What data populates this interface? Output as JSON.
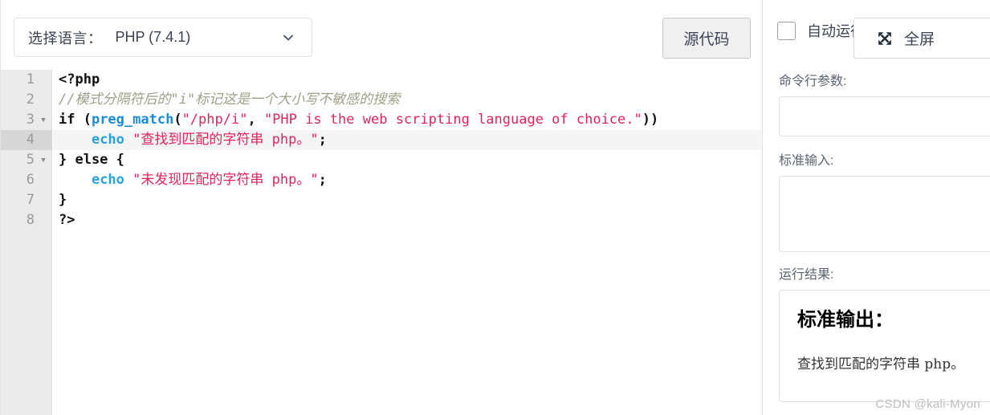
{
  "editor_toolbar": {
    "language_label": "选择语言：",
    "language_value": "PHP (7.4.1)",
    "chevron_icon": "chevron-down-icon",
    "source_button": "源代码"
  },
  "code": {
    "language": "php",
    "active_line": 4,
    "lines": [
      {
        "num": "1",
        "foldable": false,
        "active": false,
        "tokens": [
          {
            "t": "tag",
            "v": "<?php"
          }
        ]
      },
      {
        "num": "2",
        "foldable": false,
        "active": false,
        "tokens": [
          {
            "t": "comment",
            "v": "//模式分隔符后的\"i\"标记这是一个大小写不敏感的搜索"
          }
        ]
      },
      {
        "num": "3",
        "foldable": true,
        "active": false,
        "tokens": [
          {
            "t": "keyword",
            "v": "if ("
          },
          {
            "t": "func",
            "v": "preg_match"
          },
          {
            "t": "punct",
            "v": "("
          },
          {
            "t": "string",
            "v": "\"/php/i\""
          },
          {
            "t": "punct",
            "v": ", "
          },
          {
            "t": "string",
            "v": "\"PHP is the web scripting language of choice.\""
          },
          {
            "t": "punct",
            "v": "))"
          }
        ]
      },
      {
        "num": "4",
        "foldable": false,
        "active": true,
        "tokens": [
          {
            "t": "plain",
            "v": "    "
          },
          {
            "t": "echo",
            "v": "echo "
          },
          {
            "t": "string",
            "v": "\"查找到匹配的字符串 php。\""
          },
          {
            "t": "punct",
            "v": ";"
          }
        ]
      },
      {
        "num": "5",
        "foldable": true,
        "active": false,
        "tokens": [
          {
            "t": "keyword",
            "v": "} else {"
          }
        ]
      },
      {
        "num": "6",
        "foldable": false,
        "active": false,
        "tokens": [
          {
            "t": "plain",
            "v": "    "
          },
          {
            "t": "echo",
            "v": "echo "
          },
          {
            "t": "string",
            "v": "\"未发现匹配的字符串 php。\""
          },
          {
            "t": "punct",
            "v": ";"
          }
        ]
      },
      {
        "num": "7",
        "foldable": false,
        "active": false,
        "tokens": [
          {
            "t": "keyword",
            "v": "}"
          }
        ]
      },
      {
        "num": "8",
        "foldable": false,
        "active": false,
        "tokens": [
          {
            "t": "tag",
            "v": "?>"
          }
        ]
      }
    ],
    "fold_glyph": "▼"
  },
  "run_panel": {
    "auto_run_label": "自动运行",
    "auto_run_checked": false,
    "fullscreen_label": "全屏",
    "fullscreen_icon": "expand-arrows-icon",
    "args_label": "命令行参数:",
    "args_value": "",
    "stdin_label": "标准输入:",
    "stdin_value": "",
    "result_label": "运行结果:",
    "stdout_title": "标准输出：",
    "stdout_text": "查找到匹配的字符串 php。"
  },
  "watermark": "CSDN @kali-Myon",
  "colors": {
    "accent_blue": "#1a8cd8",
    "string_red": "#e3245c",
    "comment_gray": "#a0a08a",
    "gutter_bg": "#ebebeb",
    "active_line_bg": "#f5f5f5"
  }
}
